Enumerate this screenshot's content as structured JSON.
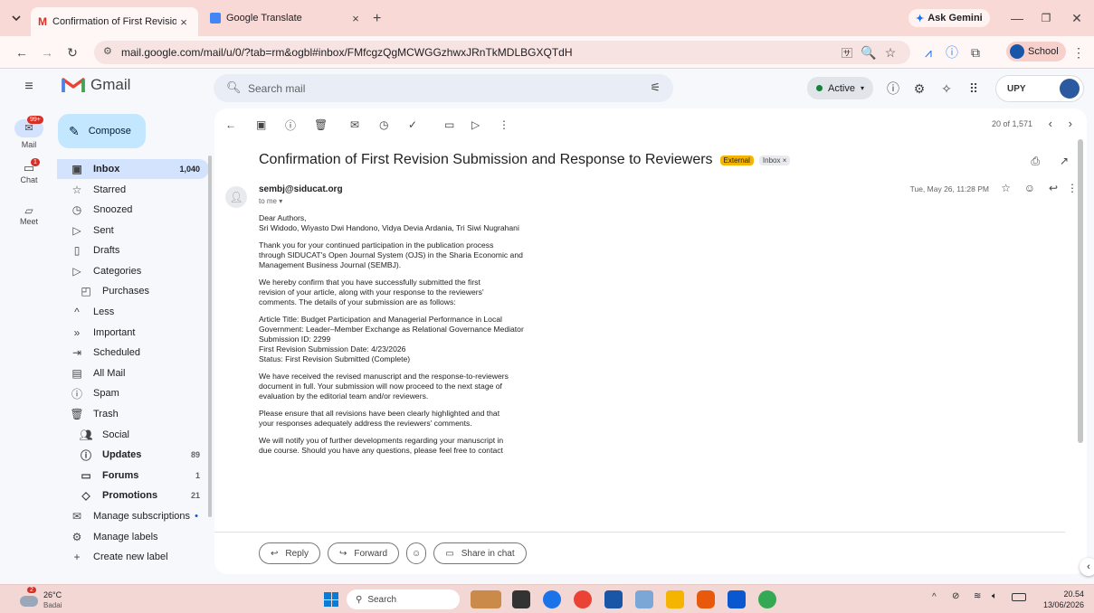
{
  "browser": {
    "tabs": [
      {
        "title": "Confirmation of First Revision S",
        "close": "×"
      },
      {
        "title": "Google Translate",
        "close": "×"
      }
    ],
    "new_tab": "+",
    "ask_gemini": "Ask Gemini",
    "url": "mail.google.com/mail/u/0/?tab=rm&ogbl#inbox/FMfcgzQgMCWGGzhwxJRnTkMDLBGXQTdH",
    "profile": "School"
  },
  "gmail": {
    "brand": "Gmail",
    "search_placeholder": "Search mail",
    "status": "Active",
    "account_badge": "UPY",
    "rail": [
      {
        "label": "Mail",
        "badge": "99+"
      },
      {
        "label": "Chat",
        "badge": "1"
      },
      {
        "label": "Meet"
      }
    ],
    "compose": "Compose",
    "nav": [
      {
        "label": "Inbox",
        "count": "1,040",
        "icon": "inbox-icon"
      },
      {
        "label": "Starred",
        "icon": "star-icon"
      },
      {
        "label": "Snoozed",
        "icon": "clock-icon"
      },
      {
        "label": "Sent",
        "icon": "send-icon"
      },
      {
        "label": "Drafts",
        "icon": "draft-icon"
      },
      {
        "label": "Categories",
        "icon": "label-icon"
      },
      {
        "label": "Purchases",
        "icon": "bag-icon"
      },
      {
        "label": "Less",
        "icon": "chevron-up-icon"
      },
      {
        "label": "Important",
        "icon": "important-icon"
      },
      {
        "label": "Scheduled",
        "icon": "scheduled-icon"
      },
      {
        "label": "All Mail",
        "icon": "all-mail-icon"
      },
      {
        "label": "Spam",
        "icon": "spam-icon"
      },
      {
        "label": "Trash",
        "icon": "trash-icon"
      },
      {
        "label": "Social",
        "icon": "social-icon"
      },
      {
        "label": "Updates",
        "count": "89",
        "icon": "info-icon"
      },
      {
        "label": "Forums",
        "count": "1",
        "icon": "forum-icon"
      },
      {
        "label": "Promotions",
        "count": "21",
        "icon": "tag-icon"
      },
      {
        "label": "Manage subscriptions",
        "icon": "subscriptions-icon"
      },
      {
        "label": "Manage labels",
        "icon": "gear-icon"
      },
      {
        "label": "Create new label",
        "icon": "plus-icon"
      }
    ],
    "pager": "20 of 1,571",
    "email": {
      "subject": "Confirmation of First Revision Submission and Response to Reviewers",
      "tag_external": "External",
      "tag_inbox": "Inbox ×",
      "sender": "sembj@siducat.org",
      "to": "to me ▾",
      "date": "Tue, May 26, 11:28 PM",
      "body": [
        "Dear Authors,",
        "Sri Widodo, Wiyasto Dwi Handono, Vidya Devia Ardania, Tri Siwi Nugrahani",
        "",
        "Thank you for your continued participation in the publication process",
        "through SIDUCAT's Open Journal System (OJS) in the Sharia Economic and",
        "Management Business Journal (SEMBJ).",
        "",
        "We hereby confirm that you have successfully submitted the first",
        "revision of your article, along with your response to the reviewers'",
        "comments. The details of your submission are as follows:",
        "",
        "Article Title: Budget Participation and Managerial Performance in Local",
        "Government: Leader–Member Exchange as Relational Governance Mediator",
        "Submission ID: 2299",
        "First Revision Submission Date: 4/23/2026",
        "Status: First Revision Submitted (Complete)",
        "",
        "We have received the revised manuscript and the response-to-reviewers",
        "document in full. Your submission will now proceed to the next stage of",
        "evaluation by the editorial team and/or reviewers.",
        "",
        "Please ensure that all revisions have been clearly highlighted and that",
        "your responses adequately address the reviewers' comments.",
        "",
        "We will notify you of further developments regarding your manuscript in",
        "due course. Should you have any questions, please feel free to contact"
      ],
      "reply": "Reply",
      "forward": "Forward",
      "share": "Share in chat"
    }
  },
  "taskbar": {
    "weather_temp": "26°C",
    "weather_text": "Badai",
    "weather_badge": "2",
    "search": "Search",
    "time": "20.54",
    "date": "13/06/2026"
  },
  "colors": {
    "accent": "#0b57d0",
    "compose": "#c2e7ff",
    "inbox_sel": "#d3e3fd",
    "external": "#f4b400",
    "badge": "#d93025"
  }
}
